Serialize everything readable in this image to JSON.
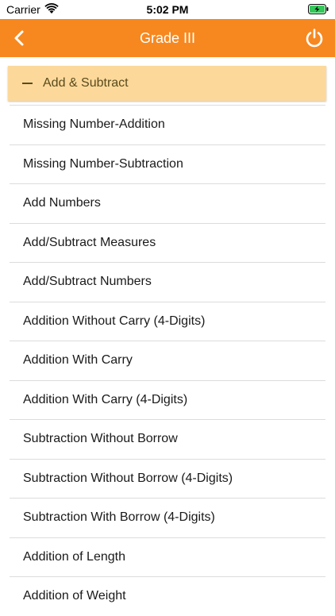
{
  "status_bar": {
    "carrier": "Carrier",
    "time": "5:02 PM"
  },
  "nav": {
    "title": "Grade III",
    "back_icon": "chevron-left-icon",
    "power_icon": "power-icon",
    "background_color": "#f7881f"
  },
  "section": {
    "title": "Add & Subtract",
    "expanded": true,
    "background_color": "#fcd99a"
  },
  "items": [
    {
      "label": "Missing Number-Addition"
    },
    {
      "label": "Missing Number-Subtraction"
    },
    {
      "label": "Add Numbers"
    },
    {
      "label": "Add/Subtract Measures"
    },
    {
      "label": "Add/Subtract Numbers"
    },
    {
      "label": "Addition Without Carry (4-Digits)"
    },
    {
      "label": "Addition With Carry"
    },
    {
      "label": "Addition With Carry (4-Digits)"
    },
    {
      "label": "Subtraction Without Borrow"
    },
    {
      "label": "Subtraction Without Borrow (4-Digits)"
    },
    {
      "label": "Subtraction With Borrow (4-Digits)"
    },
    {
      "label": "Addition of Length"
    },
    {
      "label": "Addition of Weight"
    }
  ]
}
